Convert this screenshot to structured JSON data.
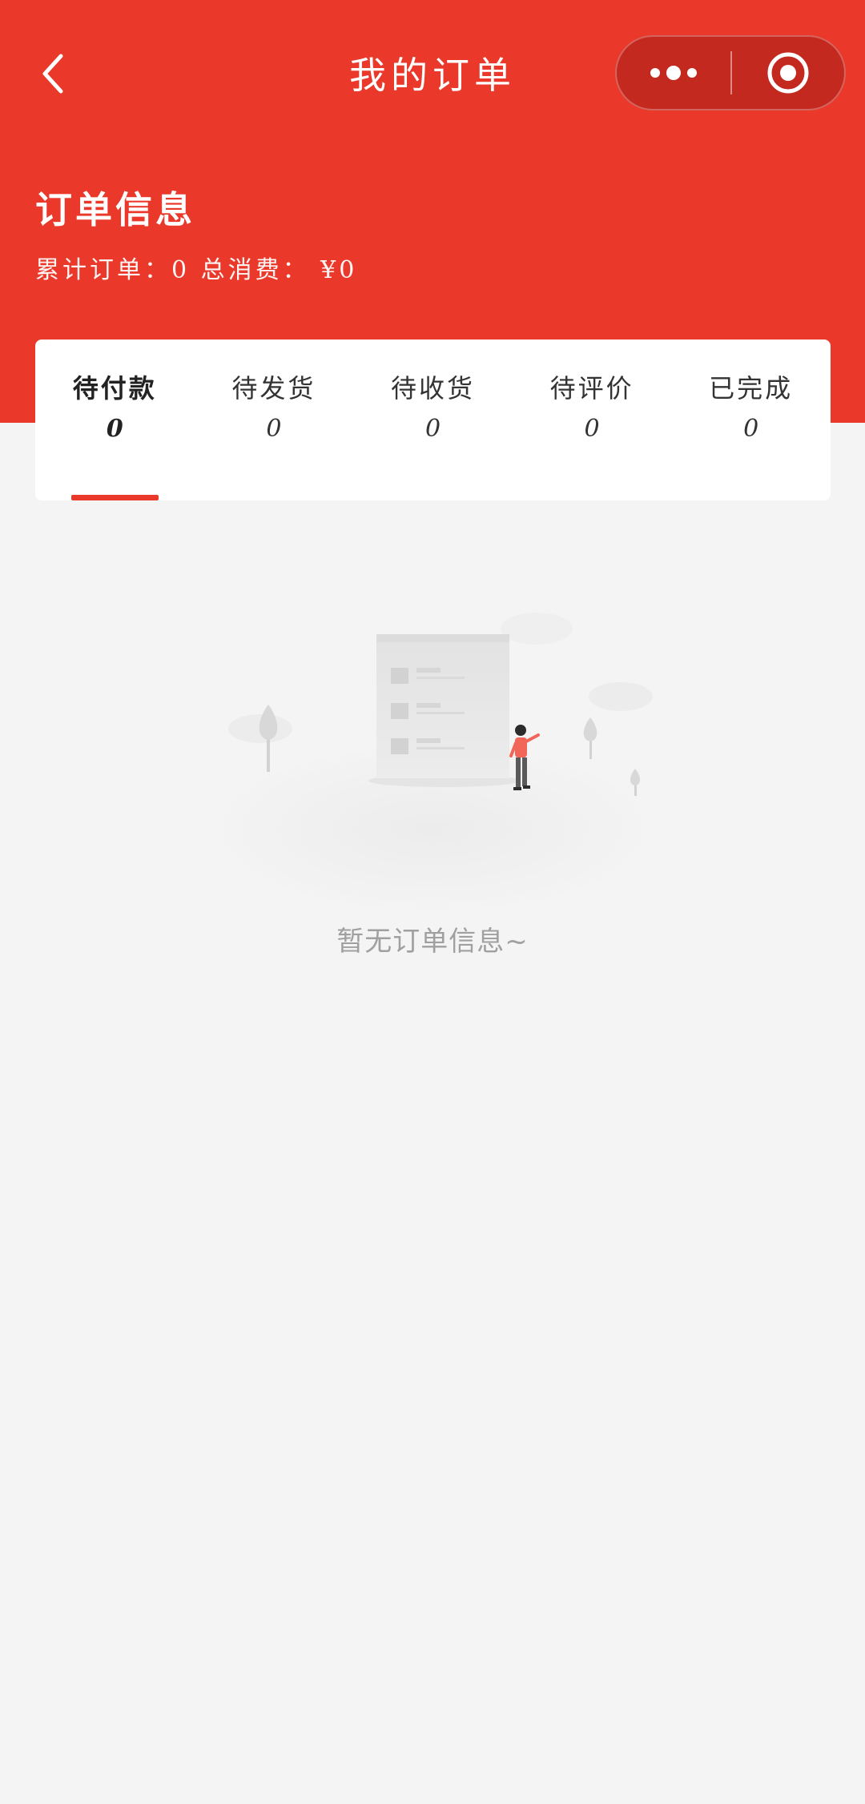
{
  "nav": {
    "title": "我的订单"
  },
  "summary": {
    "heading": "订单信息",
    "stats": "累计订单：0 总消费： ¥0"
  },
  "tabs": [
    {
      "label": "待付款",
      "count": "0"
    },
    {
      "label": "待发货",
      "count": "0"
    },
    {
      "label": "待收货",
      "count": "0"
    },
    {
      "label": "待评价",
      "count": "0"
    },
    {
      "label": "已完成",
      "count": "0"
    }
  ],
  "empty": {
    "message": "暂无订单信息~"
  },
  "icons": {
    "back": "chevron-left-icon",
    "more": "more-dots-icon",
    "close": "target-circle-icon"
  },
  "colors": {
    "brand": "#ea392b",
    "background": "#f4f4f4"
  }
}
